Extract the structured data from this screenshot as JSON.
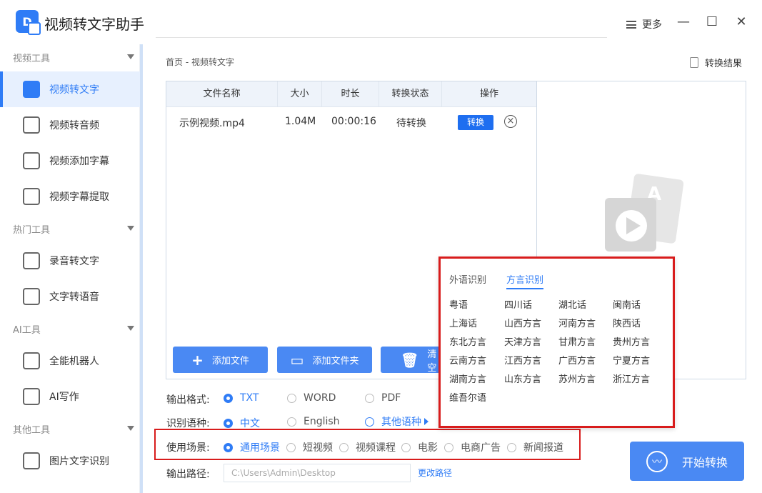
{
  "app": {
    "title": "视频转文字助手",
    "more": "更多"
  },
  "sidebar": {
    "sections": [
      "视频工具",
      "热门工具",
      "AI工具",
      "其他工具"
    ],
    "items": [
      "视频转文字",
      "视频转音频",
      "视频添加字幕",
      "视频字幕提取",
      "录音转文字",
      "文字转语音",
      "全能机器人",
      "AI写作",
      "图片文字识别"
    ]
  },
  "main": {
    "breadcrumb": "首页 - 视频转文字",
    "result_link": "转换结果",
    "table": {
      "headers": [
        "文件名称",
        "大小",
        "时长",
        "转换状态",
        "操作"
      ],
      "rows": [
        {
          "name": "示例视频.mp4",
          "size": "1.04M",
          "duration": "00:00:16",
          "status": "待转换",
          "action": "转换"
        }
      ]
    },
    "buttons": {
      "add_file": "添加文件",
      "add_folder": "添加文件夹",
      "clear": "清空"
    },
    "output_format": {
      "label": "输出格式:",
      "options": [
        "TXT",
        "WORD",
        "PDF"
      ],
      "selected": "TXT"
    },
    "lang": {
      "label": "识别语种:",
      "options": [
        "中文",
        "English",
        "其他语种"
      ],
      "selected": "中文"
    },
    "scene": {
      "label": "使用场景:",
      "options": [
        "通用场景",
        "短视频",
        "视频课程",
        "电影",
        "电商广告",
        "新闻报道"
      ],
      "selected": "通用场景"
    },
    "path": {
      "label": "输出路径:",
      "value": "C:\\Users\\Admin\\Desktop",
      "change": "更改路径"
    },
    "start": "开始转换"
  },
  "popup": {
    "tabs": [
      "外语识别",
      "方言识别"
    ],
    "active_tab": "方言识别",
    "dialects": [
      "粤语",
      "四川话",
      "湖北话",
      "闽南话",
      "上海话",
      "山西方言",
      "河南方言",
      "陕西话",
      "东北方言",
      "天津方言",
      "甘肃方言",
      "贵州方言",
      "云南方言",
      "江西方言",
      "广西方言",
      "宁夏方言",
      "湖南方言",
      "山东方言",
      "苏州方言",
      "浙江方言",
      "维吾尔语"
    ]
  },
  "colors": {
    "accent": "#2f7cf6",
    "highlight_border": "#d81c1c",
    "button": "#4a89f3"
  }
}
